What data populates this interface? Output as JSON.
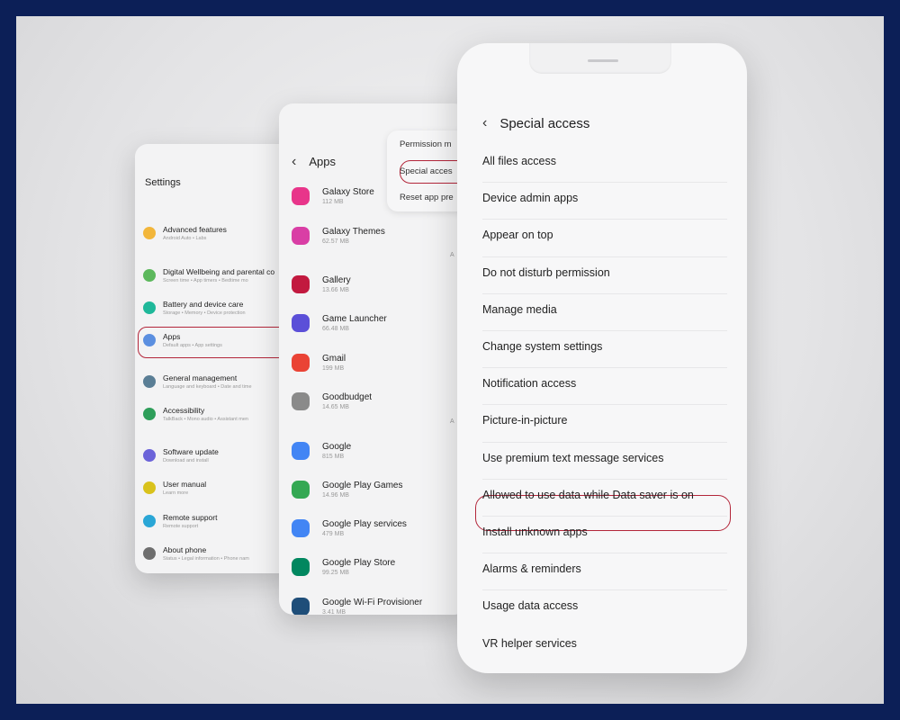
{
  "settings": {
    "title": "Settings",
    "items": [
      {
        "label": "Advanced features",
        "sub": "Android Auto • Labs",
        "color": "#f2b63b"
      },
      {
        "label": "Digital Wellbeing and parental co",
        "sub": "Screen time • App timers • Bedtime mo",
        "color": "#5cb85c"
      },
      {
        "label": "Battery and device care",
        "sub": "Storage • Memory • Device protection",
        "color": "#1fb89a"
      },
      {
        "label": "Apps",
        "sub": "Default apps • App settings",
        "color": "#5b8fe0"
      },
      {
        "label": "General management",
        "sub": "Language and keyboard • Date and time",
        "color": "#5a7e95"
      },
      {
        "label": "Accessibility",
        "sub": "TalkBack • Mono audio • Assistant men",
        "color": "#2e9e5a"
      },
      {
        "label": "Software update",
        "sub": "Download and install",
        "color": "#6b63d9"
      },
      {
        "label": "User manual",
        "sub": "Learn more",
        "color": "#d9c21c"
      },
      {
        "label": "Remote support",
        "sub": "Remote support",
        "color": "#2aa6d6"
      },
      {
        "label": "About phone",
        "sub": "Status • Legal information • Phone nam",
        "color": "#6e6e6e"
      }
    ],
    "highlight_color": "#b3263a"
  },
  "apps": {
    "title": "Apps",
    "menu": [
      "Permission m",
      "Special acces",
      "Reset app pre"
    ],
    "side_letter": "A",
    "items": [
      {
        "name": "Galaxy Store",
        "size": "112 MB",
        "color": "#e8358a"
      },
      {
        "name": "Galaxy Themes",
        "size": "62.57 MB",
        "color": "#d93ea5"
      },
      {
        "name": "Gallery",
        "size": "13.66 MB",
        "color": "#c2193f"
      },
      {
        "name": "Game Launcher",
        "size": "66.48 MB",
        "color": "#5b4fd8"
      },
      {
        "name": "Gmail",
        "size": "199 MB",
        "color": "#ea4335"
      },
      {
        "name": "Goodbudget",
        "size": "14.65 MB",
        "color": "#8a8a8a"
      },
      {
        "name": "Google",
        "size": "815 MB",
        "color": "#4285f4"
      },
      {
        "name": "Google Play Games",
        "size": "14.96 MB",
        "color": "#34a853"
      },
      {
        "name": "Google Play services",
        "size": "479 MB",
        "color": "#4285f4"
      },
      {
        "name": "Google Play Store",
        "size": "99.25 MB",
        "color": "#01875f"
      },
      {
        "name": "Google Wi-Fi Provisioner",
        "size": "3.41 MB",
        "color": "#1f4e79"
      }
    ]
  },
  "special_access": {
    "title": "Special access",
    "items": [
      "All files access",
      "Device admin apps",
      "Appear on top",
      "Do not disturb permission",
      "Manage media",
      "Change system settings",
      "Notification access",
      "Picture-in-picture",
      "Use premium text message services",
      "Allowed to use data while Data saver is on",
      "Install unknown apps",
      "Alarms & reminders",
      "Usage data access",
      "VR helper services"
    ],
    "highlighted": "Install unknown apps"
  }
}
